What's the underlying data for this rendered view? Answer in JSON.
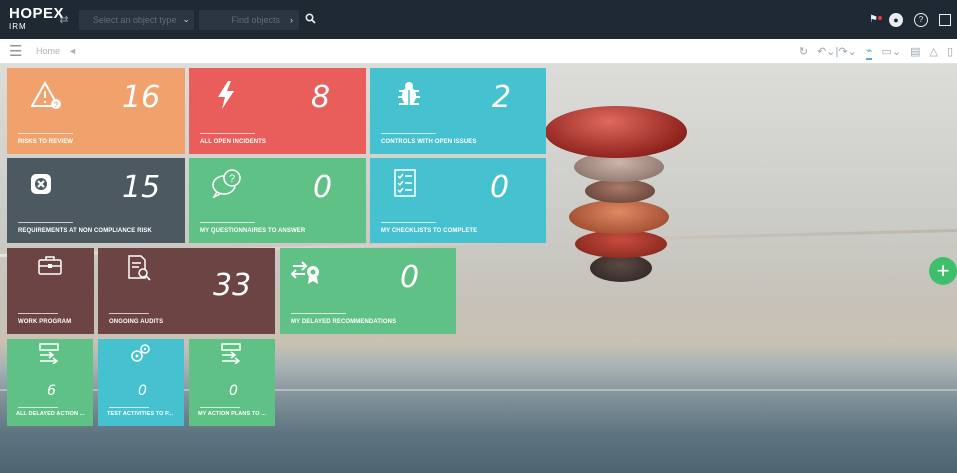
{
  "topbar": {
    "logo_main": "HOPEX",
    "logo_sub": "IRM",
    "object_type_placeholder": "Select an object type",
    "find_placeholder": "Find objects",
    "search_icon": "search-icon",
    "right_icons": [
      "flag-icon",
      "user-icon",
      "help-icon",
      "exit-icon"
    ]
  },
  "toolbar": {
    "home_label": "Home",
    "close_glyph": "◄"
  },
  "tiles": [
    {
      "id": "risks",
      "number": "16",
      "label": "RISKS TO REVIEW",
      "color": "#f1a26c",
      "icon": "warning-icon"
    },
    {
      "id": "incidents",
      "number": "8",
      "label": "ALL OPEN INCIDENTS",
      "color": "#e95e5b",
      "icon": "lightning-icon"
    },
    {
      "id": "controls",
      "number": "2",
      "label": "CONTROLS WITH OPEN ISSUES",
      "color": "#45c1d0",
      "icon": "bug-icon"
    },
    {
      "id": "requirements",
      "number": "15",
      "label": "REQUIREMENTS AT NON COMPLIANCE RISK",
      "color": "#4c5961",
      "icon": "close-box-icon"
    },
    {
      "id": "questionnaires",
      "number": "0",
      "label": "MY QUESTIONNAIRES TO ANSWER",
      "color": "#60c186",
      "icon": "question-bubble-icon"
    },
    {
      "id": "checklists",
      "number": "0",
      "label": "MY CHECKLISTS TO COMPLETE",
      "color": "#45c1d0",
      "icon": "checklist-icon"
    },
    {
      "id": "workprogram",
      "number": "",
      "label": "WORK PROGRAM",
      "color": "#6b4443",
      "icon": "briefcase-icon"
    },
    {
      "id": "audits",
      "number": "33",
      "label": "ONGOING AUDITS",
      "color": "#6b4443",
      "icon": "document-search-icon"
    },
    {
      "id": "recommendations",
      "number": "0",
      "label": "MY DELAYED RECOMMENDATIONS",
      "color": "#60c186",
      "icon": "recommendation-icon"
    },
    {
      "id": "delayedactions",
      "number": "6",
      "label": "ALL DELAYED ACTION ...",
      "color": "#60c186",
      "icon": "action-plan-icon"
    },
    {
      "id": "testactivities",
      "number": "0",
      "label": "TEST ACTIVITIES TO P...",
      "color": "#45c1d0",
      "icon": "gears-icon"
    },
    {
      "id": "actionplans",
      "number": "0",
      "label": "MY ACTION PLANS TO ...",
      "color": "#60c186",
      "icon": "action-plan-icon"
    }
  ]
}
